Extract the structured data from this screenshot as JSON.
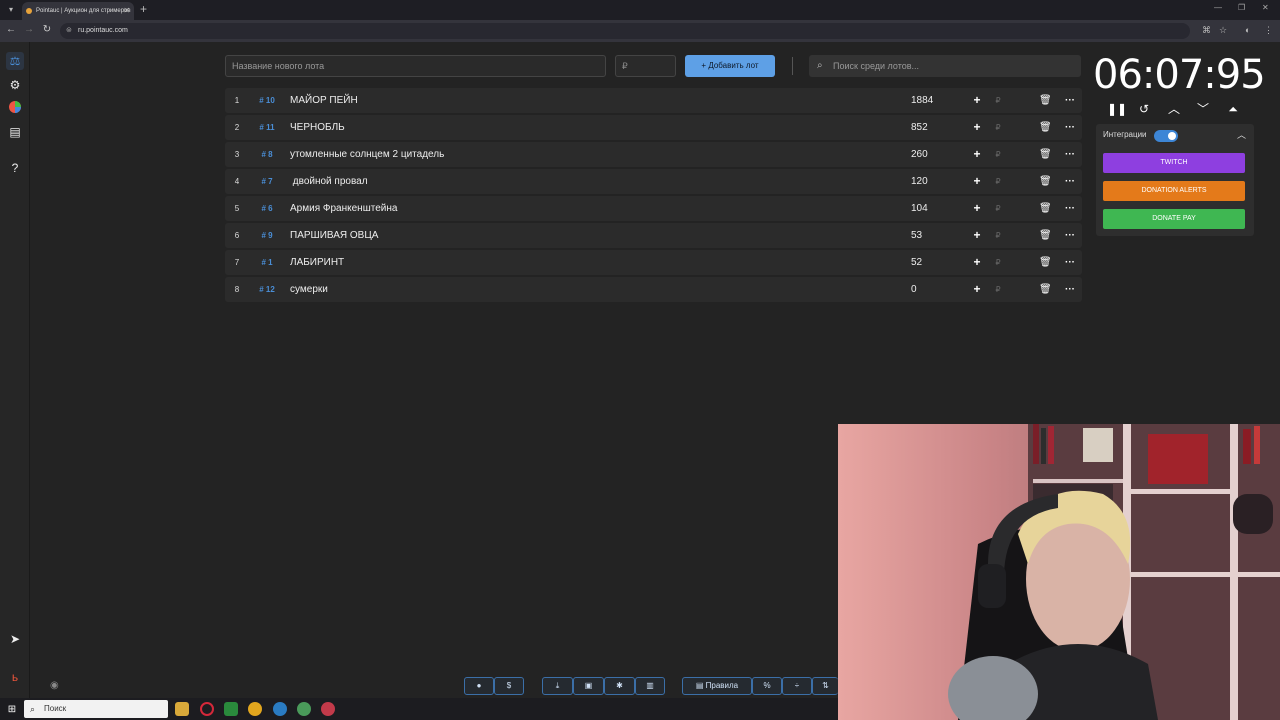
{
  "browser": {
    "tab_title": "Pointauc | Аукцион для стримеров",
    "url": "ru.pointauc.com",
    "new_tab": "+",
    "tab_close": "✕"
  },
  "form": {
    "lot_placeholder": "Название нового лота",
    "amount_placeholder": "₽",
    "add_label": "Добавить лот",
    "search_placeholder": "Поиск среди лотов..."
  },
  "lots": [
    {
      "num": "1",
      "id": "# 10",
      "name": "МАЙОР ПЕЙН",
      "amount": "1884"
    },
    {
      "num": "2",
      "id": "# 11",
      "name": "ЧЕРНОБЛЬ",
      "amount": "852"
    },
    {
      "num": "3",
      "id": "# 8",
      "name": "утомленные солнцем 2 цитадель",
      "amount": "260"
    },
    {
      "num": "4",
      "id": "# 7",
      "name": " двойной провал",
      "amount": "120"
    },
    {
      "num": "5",
      "id": "# 6",
      "name": "Армия Франкенштейна",
      "amount": "104"
    },
    {
      "num": "6",
      "id": "# 9",
      "name": "ПАРШИВАЯ ОВЦА",
      "amount": "53"
    },
    {
      "num": "7",
      "id": "# 1",
      "name": "ЛАБИРИНТ",
      "amount": "52"
    },
    {
      "num": "8",
      "id": "# 12",
      "name": "сумерки",
      "amount": "0"
    }
  ],
  "row_controls": {
    "plus": "+",
    "currency": "₽",
    "trash": "🗑",
    "more": "···"
  },
  "timer": {
    "value": "06:07:95"
  },
  "integrations": {
    "title": "Интеграции",
    "enabled": true,
    "twitch": "TWITCH",
    "donation_alerts": "DONATION ALERTS",
    "donate_pay": "DONATE PAY"
  },
  "footer": {
    "rules_label": "Правила",
    "percent_label": "%",
    "dollar_label": "$"
  },
  "taskbar": {
    "search_label": "Поиск"
  },
  "colors": {
    "accent": "#5ea0e6",
    "twitch": "#8e3fe0",
    "donation_alerts": "#e47a1a",
    "donate_pay": "#3fb752"
  },
  "icons": [
    "auction-icon",
    "settings-icon",
    "wheel-icon",
    "history-icon",
    "help-icon",
    "telegram-icon",
    "logo-icon",
    "github-icon",
    "dollar-icon",
    "download-icon",
    "save-icon",
    "bug-icon",
    "clear-icon",
    "rules-icon",
    "percent-icon",
    "divide-icon",
    "sort-icon",
    "eye-icon",
    "pause-icon",
    "restart-icon",
    "up-icon",
    "down-icon",
    "collapse-icon"
  ]
}
